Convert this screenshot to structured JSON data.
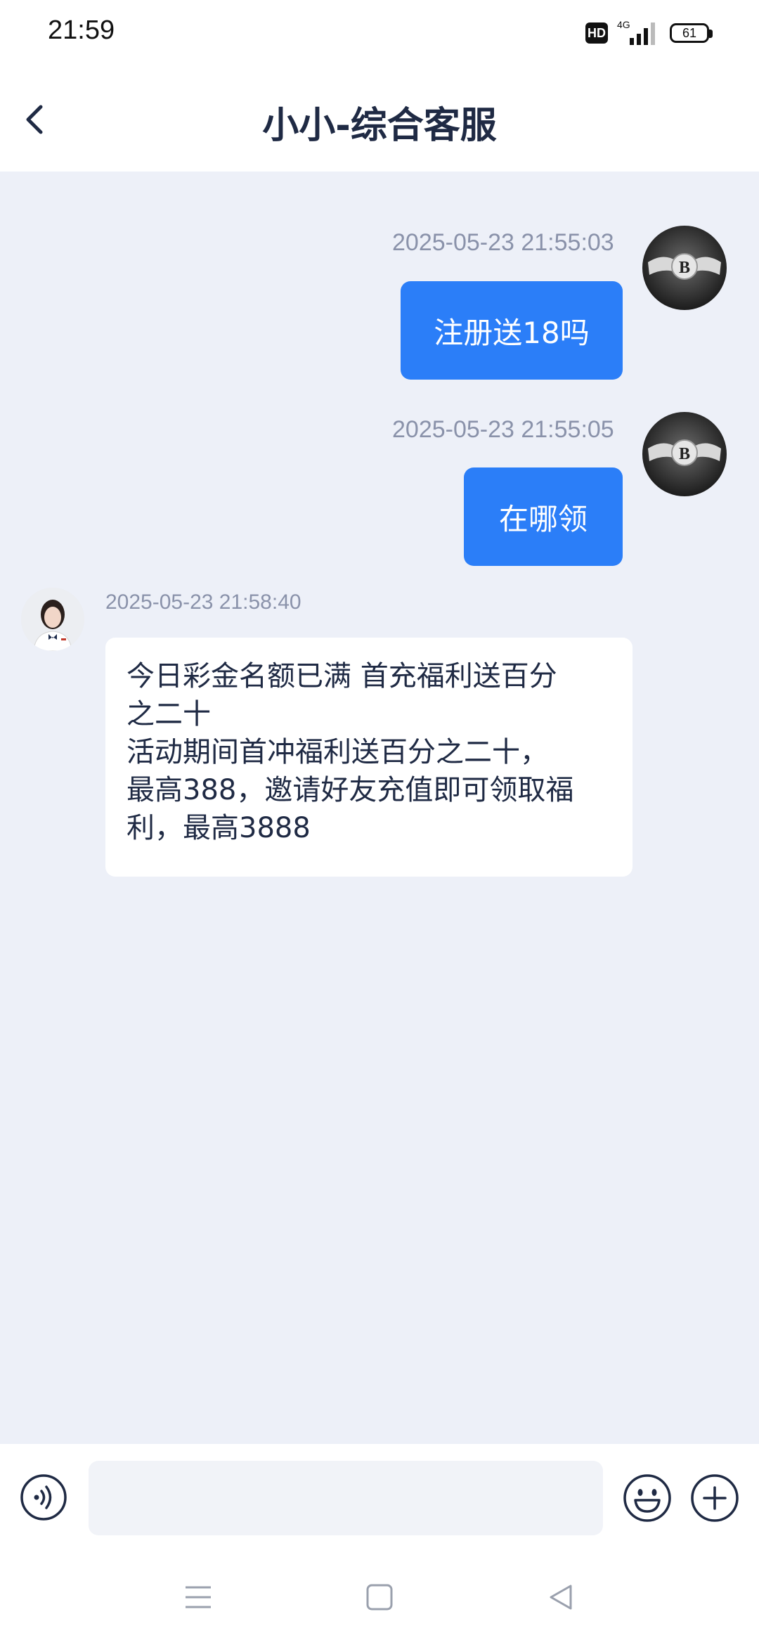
{
  "status_bar": {
    "time": "21:59",
    "hd_label": "HD",
    "network": "4G",
    "battery": "61"
  },
  "header": {
    "title": "小小-综合客服"
  },
  "messages": [
    {
      "direction": "outgoing",
      "timestamp": "2025-05-23 21:55:03",
      "text": "注册送18吗"
    },
    {
      "direction": "outgoing",
      "timestamp": "2025-05-23 21:55:05",
      "text": "在哪领"
    },
    {
      "direction": "incoming",
      "timestamp": "2025-05-23 21:58:40",
      "lines": [
        "今日彩金名额已满   首充福利送百分",
        "之二十",
        "活动期间首冲福利送百分之二十，",
        "最高388，邀请好友充值即可领取福",
        "利，最高3888"
      ]
    }
  ],
  "input_bar": {
    "value": "",
    "placeholder": ""
  },
  "icons": {
    "back": "chevron-left-icon",
    "voice": "voice-icon",
    "emoji": "emoji-icon",
    "plus": "plus-icon",
    "nav_menu": "menu-icon",
    "nav_home": "home-icon",
    "nav_back": "triangle-back-icon"
  },
  "colors": {
    "accent": "#2b7ef8",
    "chat_background": "#edf0f8",
    "timestamp": "#8a92aa",
    "title": "#1f2a44"
  }
}
